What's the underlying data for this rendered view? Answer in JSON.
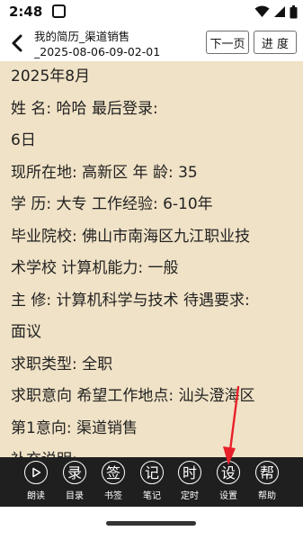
{
  "status_bar": {
    "time": "2:48"
  },
  "header": {
    "title_line1": "我的简历_渠道销售",
    "title_line2": "_2025-08-06-09-02-01",
    "next_page_label": "下一页",
    "progress_label": "进 度"
  },
  "content": {
    "lines": [
      "2025年8月",
      "姓 名:  哈哈 最后登录:",
      "6日",
      "现所在地:  高新区 年 龄:  35",
      "学    历:  大专 工作经验:  6-10年",
      "毕业院校:  佛山市南海区九江职业技",
      "术学校 计算机能力:  一般",
      "主 修:  计算机科学与技术 待遇要求:",
      "面议",
      "求职类型:  全职",
      "求职意向 希望工作地点:  汕头澄海区",
      "第1意向:  渠道销售",
      "补充说明:"
    ]
  },
  "toolbar": {
    "items": [
      {
        "name": "read-aloud",
        "glyph": "",
        "label": "朗读",
        "icon": "play-icon"
      },
      {
        "name": "catalog",
        "glyph": "录",
        "label": "目录",
        "icon": "catalog-icon"
      },
      {
        "name": "bookmark",
        "glyph": "签",
        "label": "书签",
        "icon": "bookmark-icon"
      },
      {
        "name": "notes",
        "glyph": "记",
        "label": "笔记",
        "icon": "notes-icon"
      },
      {
        "name": "timer",
        "glyph": "时",
        "label": "定时",
        "icon": "timer-icon"
      },
      {
        "name": "settings",
        "glyph": "设",
        "label": "设置",
        "icon": "settings-icon"
      },
      {
        "name": "help",
        "glyph": "帮",
        "label": "帮助",
        "icon": "help-icon"
      }
    ]
  },
  "colors": {
    "page_bg": "#f0e2c6",
    "toolbar_bg": "#1f1f1f",
    "annotation": "#e8202a"
  }
}
